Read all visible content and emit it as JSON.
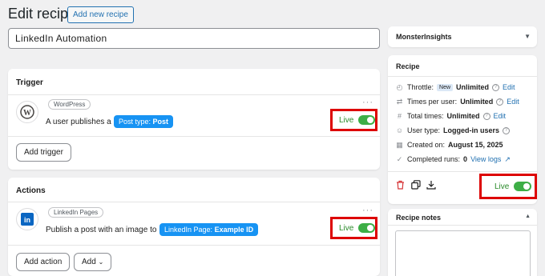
{
  "header": {
    "title": "Edit recipe",
    "add_new_label": "Add new recipe"
  },
  "recipe_title": {
    "value": "LinkedIn Automation"
  },
  "trigger": {
    "heading": "Trigger",
    "integration": "WordPress",
    "sentence": "A user publishes a",
    "pill_key": "Post type:",
    "pill_value": "Post",
    "status": "Live",
    "add_label": "Add trigger",
    "menu": "···"
  },
  "actions": {
    "heading": "Actions",
    "integration": "LinkedIn Pages",
    "sentence": "Publish a post with an image to",
    "pill_key": "LinkedIn Page:",
    "pill_value": "Example ID",
    "status": "Live",
    "add_action_label": "Add action",
    "add_label": "Add",
    "menu": "···"
  },
  "sidebar": {
    "monsterinsights": "MonsterInsights",
    "recipe": {
      "heading": "Recipe",
      "throttle_label": "Throttle:",
      "throttle_badge": "New",
      "throttle_value": "Unlimited",
      "times_per_user_label": "Times per user:",
      "times_per_user_value": "Unlimited",
      "total_times_label": "Total times:",
      "total_times_value": "Unlimited",
      "user_type_label": "User type:",
      "user_type_value": "Logged-in users",
      "created_label": "Created on:",
      "created_value": "August 15, 2025",
      "runs_label": "Completed runs:",
      "runs_value": "0",
      "edit_label": "Edit",
      "view_logs_label": "View logs",
      "status": "Live"
    },
    "notes": {
      "heading": "Recipe notes"
    }
  },
  "colors": {
    "accent": "#2271b1",
    "pill": "#1793f3",
    "live": "#3dae46",
    "highlight": "#dd0000"
  }
}
